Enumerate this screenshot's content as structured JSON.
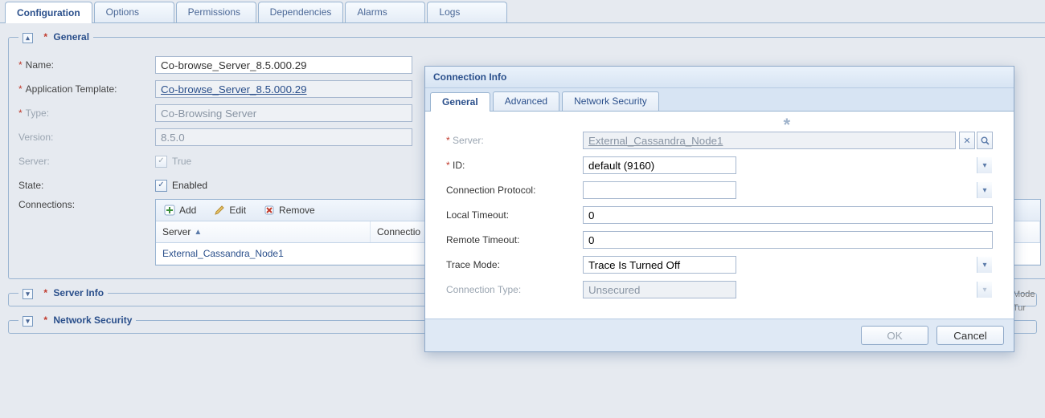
{
  "tabs": {
    "main": [
      "Configuration",
      "Options",
      "Permissions",
      "Dependencies",
      "Alarms",
      "Logs"
    ],
    "activeIndex": 0
  },
  "general": {
    "legend": "General",
    "name_label": "Name:",
    "name_value": "Co-browse_Server_8.5.000.29",
    "template_label": "Application Template:",
    "template_value": "Co-browse_Server_8.5.000.29",
    "type_label": "Type:",
    "type_value": "Co-Browsing Server",
    "version_label": "Version:",
    "version_value": "8.5.0",
    "server_label": "Server:",
    "server_checked": true,
    "server_text": "True",
    "state_label": "State:",
    "state_checked": true,
    "state_text": "Enabled",
    "connections_label": "Connections:"
  },
  "connections": {
    "toolbar": {
      "add": "Add",
      "edit": "Edit",
      "remove": "Remove"
    },
    "columns": {
      "server": "Server",
      "connection": "Connectio"
    },
    "rows": [
      {
        "server": "External_Cassandra_Node1",
        "connection": ""
      }
    ],
    "behind_hint_lines": [
      "Mode",
      "Tur"
    ]
  },
  "sections": {
    "server_info_legend": "Server Info",
    "network_security_legend": "Network Security"
  },
  "dialog": {
    "title": "Connection Info",
    "tabs": [
      "General",
      "Advanced",
      "Network Security"
    ],
    "activeTabIndex": 0,
    "fields": {
      "server_label": "Server:",
      "server_value": "External_Cassandra_Node1",
      "id_label": "ID:",
      "id_value": "default (9160)",
      "protocol_label": "Connection Protocol:",
      "protocol_value": "",
      "local_timeout_label": "Local Timeout:",
      "local_timeout_value": "0",
      "remote_timeout_label": "Remote Timeout:",
      "remote_timeout_value": "0",
      "trace_label": "Trace Mode:",
      "trace_value": "Trace Is Turned Off",
      "conn_type_label": "Connection Type:",
      "conn_type_value": "Unsecured"
    },
    "buttons": {
      "ok": "OK",
      "cancel": "Cancel"
    }
  }
}
